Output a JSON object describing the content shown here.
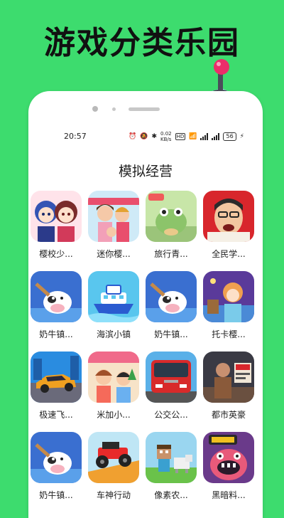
{
  "promo": {
    "title": "游戏分类乐园"
  },
  "status": {
    "time": "20:57",
    "speed": "0.02",
    "speed_unit": "KB/s",
    "hd": "HD",
    "battery": "56"
  },
  "page": {
    "title": "模拟经营"
  },
  "apps": [
    {
      "name": "樱校少...",
      "icon": "anime-girls-icon"
    },
    {
      "name": "迷你樱...",
      "icon": "cartoon-family-icon"
    },
    {
      "name": "旅行青...",
      "icon": "travel-frog-icon"
    },
    {
      "name": "全民学...",
      "icon": "crying-man-icon"
    },
    {
      "name": "奶牛镇...",
      "icon": "cow-town-icon"
    },
    {
      "name": "海滨小镇",
      "icon": "seaside-ship-icon"
    },
    {
      "name": "奶牛镇...",
      "icon": "cow-town-icon"
    },
    {
      "name": "托卡樱...",
      "icon": "toca-girl-icon"
    },
    {
      "name": "极速飞...",
      "icon": "racing-car-icon"
    },
    {
      "name": "米加小...",
      "icon": "miga-kids-icon"
    },
    {
      "name": "公交公...",
      "icon": "red-bus-icon"
    },
    {
      "name": "都市英豪",
      "icon": "city-hero-icon"
    },
    {
      "name": "奶牛镇...",
      "icon": "cow-town-icon"
    },
    {
      "name": "车神行动",
      "icon": "monster-truck-icon"
    },
    {
      "name": "像素农...",
      "icon": "pixel-farm-icon"
    },
    {
      "name": "黑暗料...",
      "icon": "dark-kitchen-icon"
    }
  ],
  "colors": {
    "background": "#3ddc6e",
    "card": "#ffffff"
  }
}
